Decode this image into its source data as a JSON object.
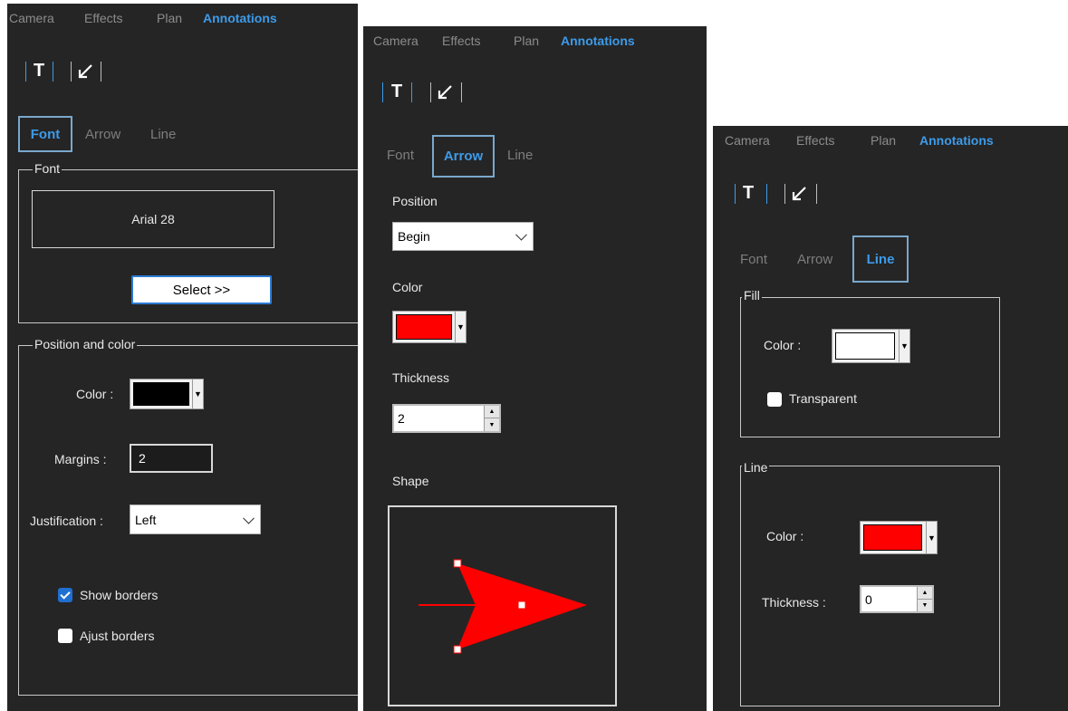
{
  "top_tabs": [
    "Camera",
    "Effects",
    "Plan",
    "Annotations"
  ],
  "tool_icons": [
    "text-icon",
    "arrow-icon"
  ],
  "sub_tabs": [
    "Font",
    "Arrow",
    "Line"
  ],
  "panel1": {
    "active_subtab": "Font",
    "font_group": {
      "title": "Font",
      "font_display": "Arial 28",
      "select_button": "Select >>"
    },
    "position_group": {
      "title": "Position and color",
      "color_label": "Color :",
      "color_value": "#000000",
      "margins_label": "Margins :",
      "margins_value": "2",
      "justification_label": "Justification :",
      "justification_value": "Left",
      "show_borders_label": "Show borders",
      "show_borders_checked": true,
      "ajust_borders_label": "Ajust borders",
      "ajust_borders_checked": false
    }
  },
  "panel2": {
    "active_subtab": "Arrow",
    "position_label": "Position",
    "position_value": "Begin",
    "color_label": "Color",
    "color_value": "#ff0000",
    "thickness_label": "Thickness",
    "thickness_value": "2",
    "shape_label": "Shape"
  },
  "panel3": {
    "active_subtab": "Line",
    "fill_group": {
      "title": "Fill",
      "color_label": "Color :",
      "color_value": "#ffffff",
      "transparent_label": "Transparent",
      "transparent_checked": false
    },
    "line_group": {
      "title": "Line",
      "color_label": "Color :",
      "color_value": "#ff0000",
      "thickness_label": "Thickness :",
      "thickness_value": "0"
    }
  }
}
